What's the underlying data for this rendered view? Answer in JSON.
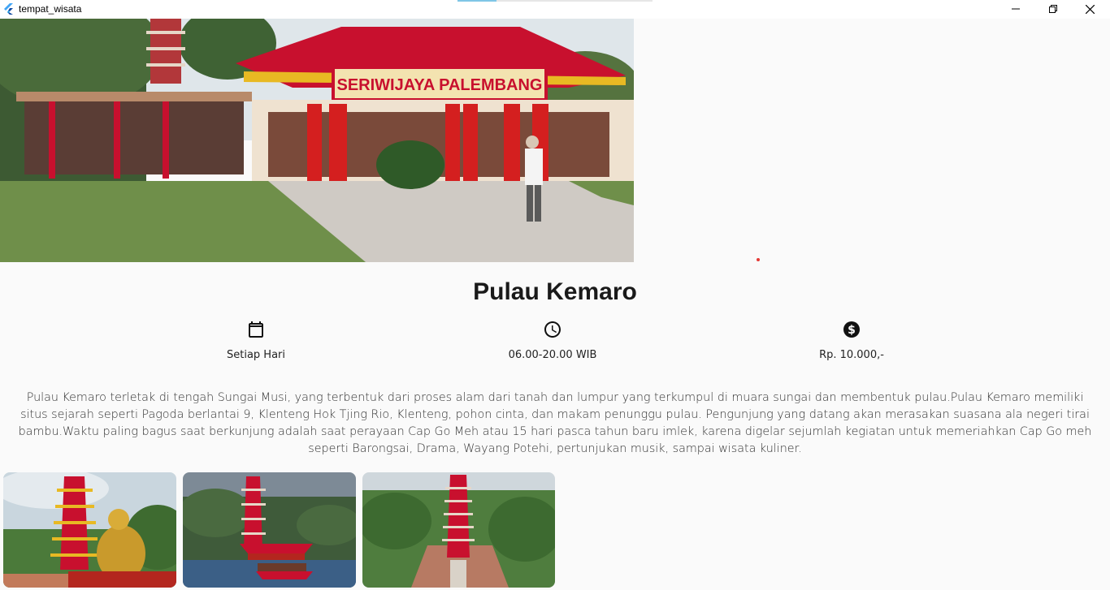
{
  "window": {
    "title": "tempat_wisata",
    "controls": [
      "minimize",
      "maximize",
      "close"
    ]
  },
  "hero": {
    "sign_text": "SERIWIJAYA PALEMBANG"
  },
  "place": {
    "name": "Pulau Kemaro"
  },
  "info": {
    "days": {
      "icon": "calendar-icon",
      "label": "Setiap Hari"
    },
    "hours": {
      "icon": "clock-icon",
      "label": "06.00-20.00 WIB"
    },
    "price": {
      "icon": "dollar-icon",
      "label": "Rp. 10.000,-"
    }
  },
  "description": "Pulau Kemaro terletak di tengah Sungai Musi, yang terbentuk dari proses alam dari tanah dan lumpur yang terkumpul di muara sungai dan membentuk pulau.Pulau Kemaro memiliki situs sejarah seperti Pagoda berlantai 9, Klenteng Hok Tjing Rio, Klenteng, pohon cinta, dan makam penunggu pulau. Pengunjung yang datang akan merasakan suasana ala negeri tirai bambu.Waktu paling bagus saat berkunjung adalah saat perayaan Cap Go Meh atau 15 hari pasca tahun baru imlek, karena digelar sejumlah kegiatan untuk memeriahkan Cap Go meh seperti Barongsai, Drama, Wayang Potehi, pertunjukan musik, sampai wisata kuliner.",
  "colors": {
    "background": "#fafafa",
    "accent_red": "#c8102e",
    "gold": "#e8b923",
    "loading_dot": "#e53935"
  }
}
